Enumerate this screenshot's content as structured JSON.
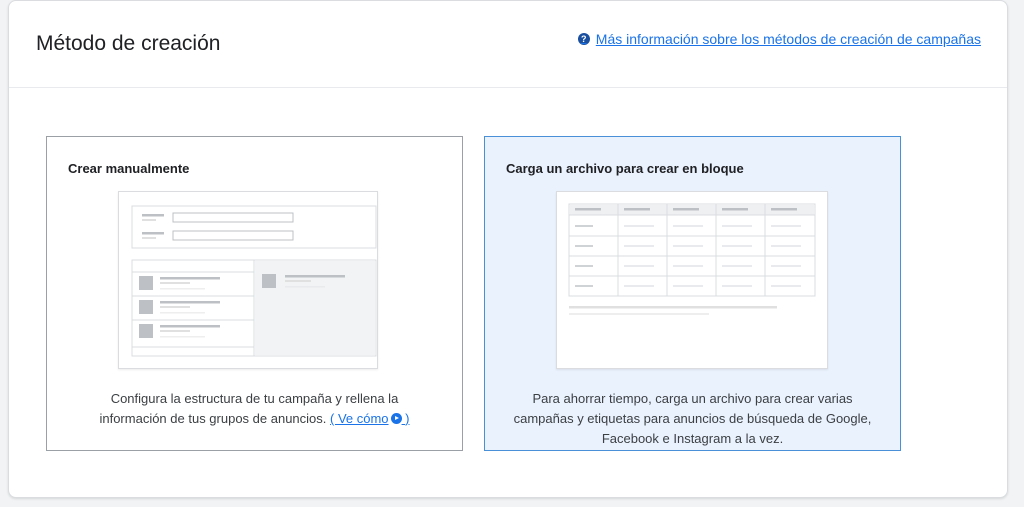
{
  "header": {
    "title": "Método de creación",
    "help_link": "Más información sobre los métodos de creación de campañas"
  },
  "cards": {
    "manual": {
      "title": "Crear manualmente",
      "desc_line1": "Configura la estructura de tu campaña y rellena la",
      "desc_line2": "información de tus grupos de anuncios.",
      "see_how": "( Ve cómo",
      "see_how_close": ")"
    },
    "bulk": {
      "title": "Carga un archivo para crear en bloque",
      "desc_line1": "Para ahorrar tiempo, carga un archivo para crear varias",
      "desc_line2": "campañas y etiquetas para anuncios de búsqueda de Google,",
      "desc_line3": "Facebook e Instagram a la vez."
    }
  },
  "colors": {
    "accent": "#1a73e8",
    "selected_bg": "#eaf2fe",
    "selected_border": "#4a90d9"
  }
}
